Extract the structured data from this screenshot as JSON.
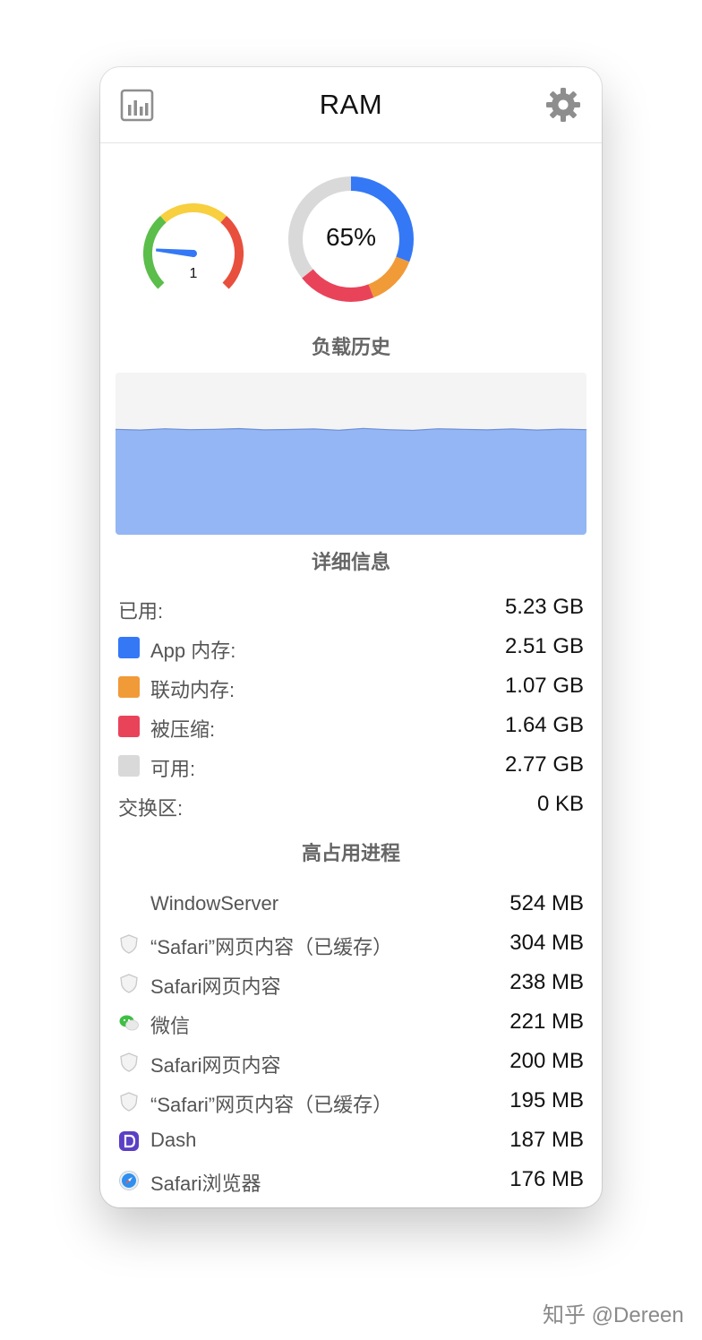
{
  "window": {
    "title": "RAM"
  },
  "gauge": {
    "value": "1",
    "level": 0.03
  },
  "donut": {
    "label": "65%",
    "segments": [
      {
        "name": "app",
        "fraction": 0.309,
        "color": "#3478f6"
      },
      {
        "name": "wired",
        "fraction": 0.132,
        "color": "#f19a38"
      },
      {
        "name": "compressed",
        "fraction": 0.202,
        "color": "#e9435a"
      },
      {
        "name": "free",
        "fraction": 0.357,
        "color": "#d9d9d9"
      }
    ]
  },
  "history": {
    "title": "负载历史",
    "fill_color": "#95b6f5",
    "level": 0.65
  },
  "details": {
    "title": "详细信息",
    "used": {
      "label": "已用:",
      "value": "5.23 GB"
    },
    "items": [
      {
        "label": "App 内存:",
        "value": "2.51 GB",
        "color": "#3478f6"
      },
      {
        "label": "联动内存:",
        "value": "1.07 GB",
        "color": "#f19a38"
      },
      {
        "label": "被压缩:",
        "value": "1.64 GB",
        "color": "#e9435a"
      },
      {
        "label": "可用:",
        "value": "2.77 GB",
        "color": "#d9d9d9"
      }
    ],
    "swap": {
      "label": "交换区:",
      "value": "0 KB"
    }
  },
  "processes": {
    "title": "高占用进程",
    "items": [
      {
        "name": "WindowServer",
        "value": "524 MB",
        "icon": "none"
      },
      {
        "name": "“Safari”网页内容（已缓存）",
        "value": "304 MB",
        "icon": "shield-icon"
      },
      {
        "name": "Safari网页内容",
        "value": "238 MB",
        "icon": "shield-icon"
      },
      {
        "name": "微信",
        "value": "221 MB",
        "icon": "wechat-icon"
      },
      {
        "name": "Safari网页内容",
        "value": "200 MB",
        "icon": "shield-icon"
      },
      {
        "name": "“Safari”网页内容（已缓存）",
        "value": "195 MB",
        "icon": "shield-icon"
      },
      {
        "name": "Dash",
        "value": "187 MB",
        "icon": "dash-icon"
      },
      {
        "name": "Safari浏览器",
        "value": "176 MB",
        "icon": "safari-compass-icon"
      }
    ]
  },
  "watermark": "知乎 @Dereen"
}
